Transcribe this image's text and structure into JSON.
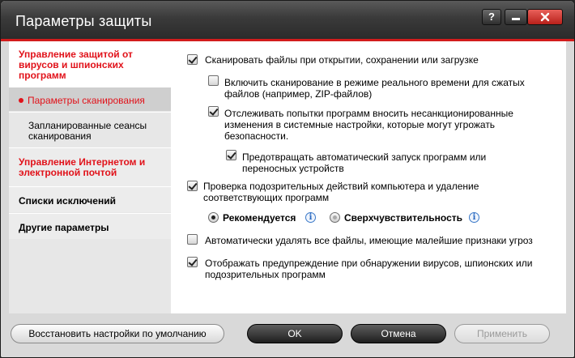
{
  "window": {
    "title": "Параметры защиты",
    "help_label": "?"
  },
  "nav": {
    "header": "Управление защитой от вирусов и шпионских программ",
    "items": [
      {
        "label": "Параметры сканирования",
        "selected": true
      },
      {
        "label": "Запланированные сеансы сканирования"
      },
      {
        "label": "Управление Интернетом и электронной почтой"
      },
      {
        "label": "Списки исключений"
      },
      {
        "label": "Другие параметры"
      }
    ]
  },
  "options": {
    "scan_on_open": {
      "label": "Сканировать файлы при открытии, сохранении или загрузке",
      "checked": true
    },
    "realtime_compressed": {
      "label": "Включить сканирование в режиме реального времени для сжатых файлов (например, ZIP-файлов)",
      "checked": false
    },
    "track_unauthorized": {
      "label": "Отслеживать попытки программ вносить несанкционированные изменения в системные настройки, которые могут угрожать безопасности.",
      "checked": true
    },
    "prevent_autorun": {
      "label": "Предотвращать автоматический запуск программ или переносных устройств",
      "checked": true
    },
    "suspicious_actions": {
      "label": "Проверка подозрительных действий компьютера и удаление соответствующих программ",
      "checked": true
    },
    "radio_recommended": {
      "label": "Рекомендуется",
      "selected": true
    },
    "radio_hypersensitive": {
      "label": "Сверхчувствительность",
      "selected": false
    },
    "auto_delete": {
      "label": "Автоматически удалять все файлы, имеющие малейшие признаки угроз",
      "checked": false
    },
    "show_warning": {
      "label": "Отображать предупреждение при обнаружении вирусов, шпионских или подозрительных программ",
      "checked": true
    }
  },
  "buttons": {
    "restore_defaults": "Восстановить настройки по умолчанию",
    "ok": "OK",
    "cancel": "Отмена",
    "apply": "Применить"
  },
  "colors": {
    "accent_red": "#e1121a",
    "titlebar": "#3a3a3a",
    "info_blue": "#2a68c0"
  }
}
